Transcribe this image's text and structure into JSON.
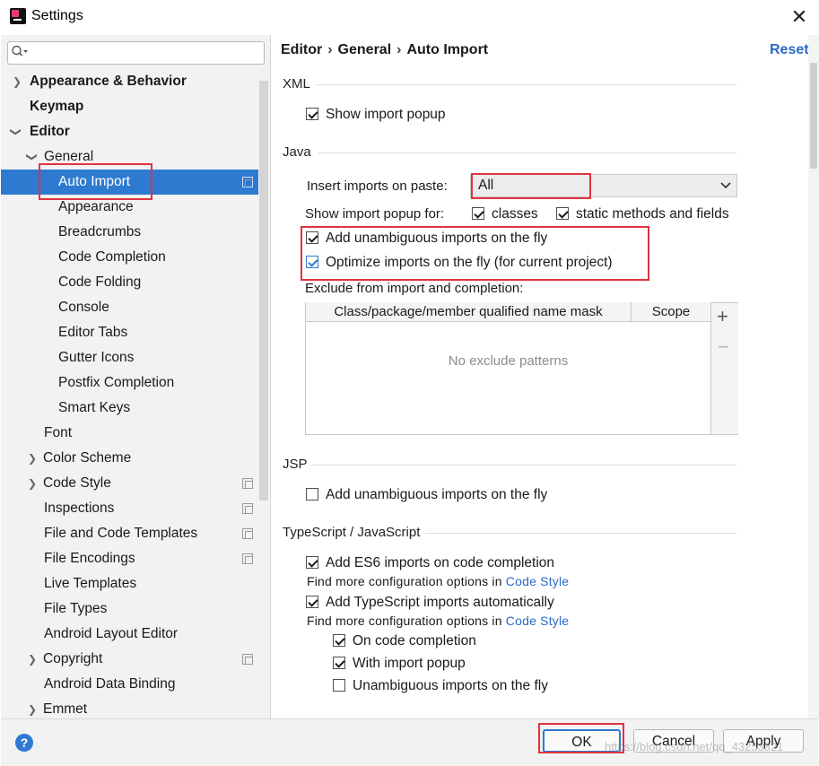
{
  "window": {
    "title": "Settings"
  },
  "search": {
    "placeholder": ""
  },
  "sidebar": {
    "items": [
      {
        "label": "Appearance & Behavior"
      },
      {
        "label": "Keymap"
      },
      {
        "label": "Editor"
      },
      {
        "label": "General"
      },
      {
        "label": "Auto Import"
      },
      {
        "label": "Appearance"
      },
      {
        "label": "Breadcrumbs"
      },
      {
        "label": "Code Completion"
      },
      {
        "label": "Code Folding"
      },
      {
        "label": "Console"
      },
      {
        "label": "Editor Tabs"
      },
      {
        "label": "Gutter Icons"
      },
      {
        "label": "Postfix Completion"
      },
      {
        "label": "Smart Keys"
      },
      {
        "label": "Font"
      },
      {
        "label": "Color Scheme"
      },
      {
        "label": "Code Style"
      },
      {
        "label": "Inspections"
      },
      {
        "label": "File and Code Templates"
      },
      {
        "label": "File Encodings"
      },
      {
        "label": "Live Templates"
      },
      {
        "label": "File Types"
      },
      {
        "label": "Android Layout Editor"
      },
      {
        "label": "Copyright"
      },
      {
        "label": "Android Data Binding"
      },
      {
        "label": "Emmet"
      }
    ]
  },
  "breadcrumb": {
    "part1": "Editor",
    "part2": "General",
    "part3": "Auto Import",
    "sep": "›"
  },
  "reset_label": "Reset",
  "xml": {
    "section": "XML",
    "show_popup": {
      "label": "Show import popup",
      "checked": true
    }
  },
  "java": {
    "section": "Java",
    "insert_label": "Insert imports on paste:",
    "insert_value": "All",
    "popup_for_label": "Show import popup for:",
    "classes": {
      "label": "classes",
      "checked": true
    },
    "static_methods": {
      "label": "static methods and fields",
      "checked": true
    },
    "add_unambiguous": {
      "label": "Add unambiguous imports on the fly",
      "checked": true
    },
    "optimize": {
      "label": "Optimize imports on the fly (for current project)",
      "checked": true
    },
    "exclude_label": "Exclude from import and completion:",
    "table": {
      "col1": "Class/package/member qualified name mask",
      "col2": "Scope",
      "empty_text": "No exclude patterns",
      "add": "+",
      "remove": "−"
    }
  },
  "jsp": {
    "section": "JSP",
    "add_unambiguous": {
      "label": "Add unambiguous imports on the fly",
      "checked": false
    }
  },
  "ts": {
    "section": "TypeScript / JavaScript",
    "es6": {
      "label": "Add ES6 imports on code completion",
      "checked": true
    },
    "hint1": "Find more configuration options in",
    "hint1_link": "Code Style",
    "ts_auto": {
      "label": "Add TypeScript imports automatically",
      "checked": true
    },
    "hint2": "Find more configuration options in",
    "hint2_link": "Code Style",
    "on_completion": {
      "label": "On code completion",
      "checked": true
    },
    "with_popup": {
      "label": "With import popup",
      "checked": true
    },
    "unambiguous": {
      "label": "Unambiguous imports on the fly",
      "checked": false
    }
  },
  "footer": {
    "help": "?",
    "ok": "OK",
    "cancel": "Cancel",
    "apply": "Apply",
    "watermark": "https://blog.csdn.net/qq_43253321"
  },
  "colors": {
    "accent": "#2f7ad1",
    "highlight": "#e0333f",
    "link": "#2a6bc6"
  }
}
